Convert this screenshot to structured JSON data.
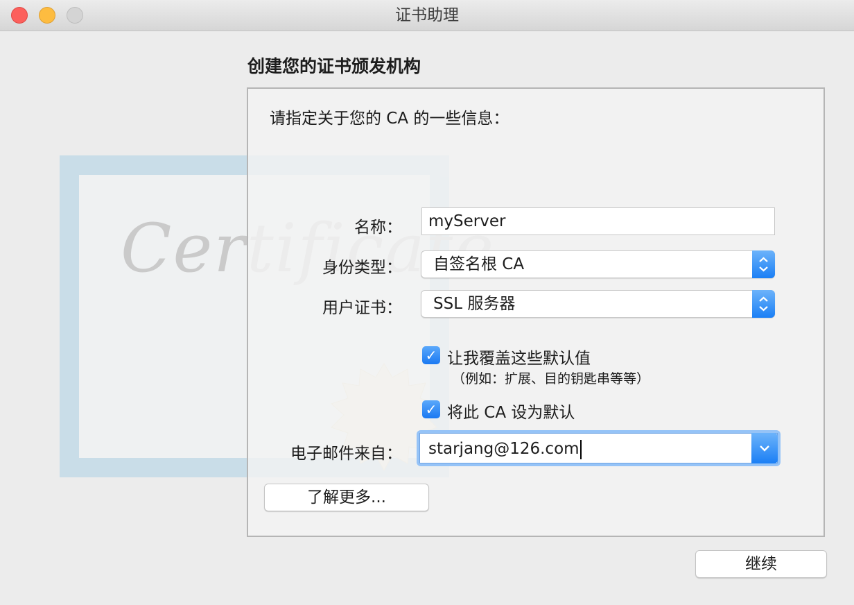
{
  "window": {
    "title": "证书助理",
    "controls": [
      "close",
      "minimize",
      "zoom"
    ]
  },
  "decoration": {
    "certificate_script": "Certificate"
  },
  "heading": "创建您的证书颁发机构",
  "prompt": "请指定关于您的 CA 的一些信息：",
  "form": {
    "name_label": "名称：",
    "name_value": "myServer",
    "identity_label": "身份类型：",
    "identity_value": "自签名根 CA",
    "user_cert_label": "用户证书：",
    "user_cert_value": "SSL 服务器",
    "override_label": "让我覆盖这些默认值",
    "override_checked": true,
    "override_note": "（例如：扩展、目的钥匙串等等）",
    "default_label": "将此 CA 设为默认",
    "default_checked": true,
    "email_label": "电子邮件来自：",
    "email_value": "starjang@126.com"
  },
  "buttons": {
    "learn_more": "了解更多...",
    "continue": "继续"
  },
  "colors": {
    "accent": "#1b7ff5",
    "focus_ring": "#95c3f7",
    "close": "#fc605c",
    "minimize": "#fdbc40"
  }
}
